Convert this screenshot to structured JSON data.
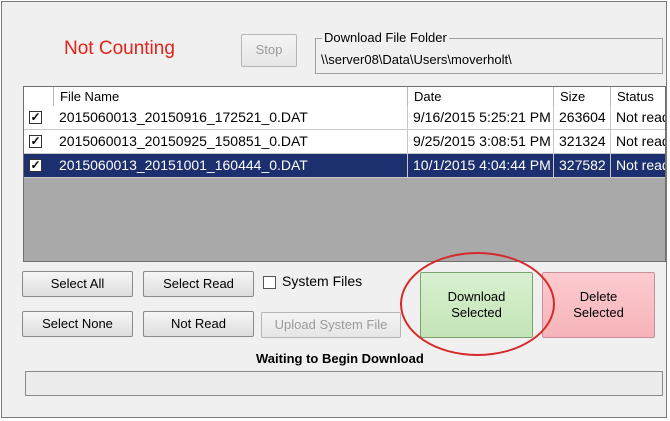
{
  "counting_status": "Not Counting",
  "stop_button": "Stop",
  "download_folder": {
    "title": "Download File Folder",
    "path": "\\\\server08\\Data\\Users\\moverholt\\"
  },
  "file_list": {
    "columns": [
      "File Name",
      "Date",
      "Size",
      "Status"
    ],
    "rows": [
      {
        "checked": true,
        "selected": false,
        "name": "2015060013_20150916_172521_0.DAT",
        "date": "9/16/2015 5:25:21 PM",
        "size": "263604",
        "status": "Not read"
      },
      {
        "checked": true,
        "selected": false,
        "name": "2015060013_20150925_150851_0.DAT",
        "date": "9/25/2015 3:08:51 PM",
        "size": "321324",
        "status": "Not read"
      },
      {
        "checked": true,
        "selected": true,
        "name": "2015060013_20151001_160444_0.DAT",
        "date": "10/1/2015 4:04:44 PM",
        "size": "327582",
        "status": "Not read"
      }
    ]
  },
  "buttons": {
    "select_all": "Select All",
    "select_read": "Select Read",
    "select_none": "Select None",
    "not_read": "Not Read",
    "upload_system_file": "Upload System File",
    "download_selected_line1": "Download",
    "download_selected_line2": "Selected",
    "delete_selected_line1": "Delete",
    "delete_selected_line2": "Selected"
  },
  "system_files_label": "System Files",
  "system_files_checked": false,
  "waiting_text": "Waiting to Begin Download",
  "download_progress": 0,
  "colors": {
    "not_counting": "#e2231a",
    "selected_row": "#1c2f6e",
    "download_button": "#c8e7bd",
    "delete_button": "#f7bcc1",
    "highlight_ring": "#d62a2a"
  },
  "icons": {
    "checkbox_checked": "checkmark-icon"
  }
}
